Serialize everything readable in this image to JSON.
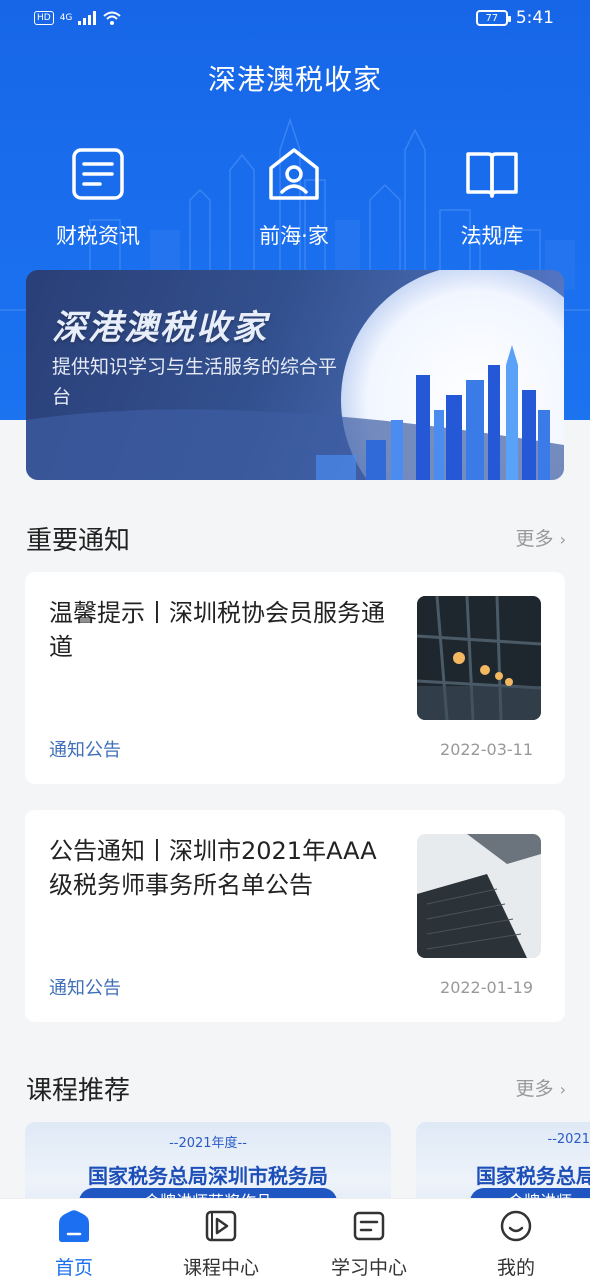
{
  "status_bar": {
    "network": "4G",
    "battery": "77",
    "time": "5:41",
    "hd": "HD"
  },
  "header": {
    "title": "深港澳税收家"
  },
  "shortcuts": [
    {
      "label": "财税资讯",
      "icon": "document-icon"
    },
    {
      "label": "前海·家",
      "icon": "home-person-icon"
    },
    {
      "label": "法规库",
      "icon": "book-icon"
    }
  ],
  "banner": {
    "title": "深港澳税收家",
    "subtitle": "提供知识学习与生活服务的综合平台"
  },
  "notices": {
    "title": "重要通知",
    "more": "更多",
    "items": [
      {
        "title": "温馨提示丨深圳税协会员服务通道",
        "tag": "通知公告",
        "date": "2022-03-11"
      },
      {
        "title": "公告通知丨深圳市2021年AAA级税务师事务所名单公告",
        "tag": "通知公告",
        "date": "2022-01-19"
      }
    ]
  },
  "courses": {
    "title": "课程推荐",
    "more": "更多",
    "items": [
      {
        "year": "--2021年度--",
        "title": "国家税务总局深圳市税务局",
        "pill": "金牌讲师获奖作品"
      },
      {
        "year": "--2021",
        "title": "国家税务总局",
        "pill": "金牌讲师"
      }
    ]
  },
  "tabbar": [
    {
      "label": "首页",
      "icon": "home-icon",
      "active": true
    },
    {
      "label": "课程中心",
      "icon": "video-icon",
      "active": false
    },
    {
      "label": "学习中心",
      "icon": "notes-icon",
      "active": false
    },
    {
      "label": "我的",
      "icon": "smile-icon",
      "active": false
    }
  ],
  "colors": {
    "primary": "#1b6ff0",
    "tag": "#3f6fb8"
  }
}
